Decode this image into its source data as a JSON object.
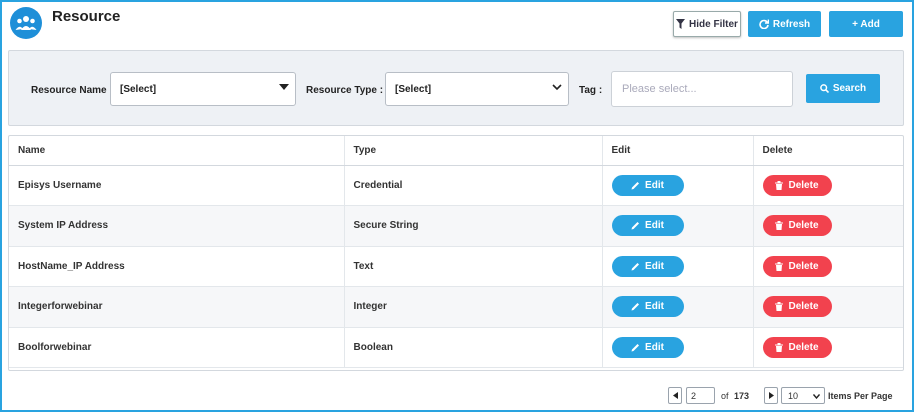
{
  "header": {
    "title": "Resource",
    "hide_filter_label": "Hide Filter",
    "refresh_label": "Refresh",
    "add_label": "+ Add"
  },
  "filter": {
    "resource_name_label": "Resource Name :",
    "resource_name_value": "[Select]",
    "resource_type_label": "Resource Type :",
    "resource_type_value": "[Select]",
    "tag_label": "Tag :",
    "tag_placeholder": "Please select...",
    "search_label": "Search"
  },
  "table": {
    "columns": [
      "Name",
      "Type",
      "Edit",
      "Delete"
    ],
    "rows": [
      {
        "name": "Episys Username",
        "type": "Credential"
      },
      {
        "name": "System IP Address",
        "type": "Secure String"
      },
      {
        "name": "HostName_IP Address",
        "type": "Text"
      },
      {
        "name": "Integerforwebinar",
        "type": "Integer"
      },
      {
        "name": "Boolforwebinar",
        "type": "Boolean"
      }
    ],
    "edit_label": "Edit",
    "delete_label": "Delete"
  },
  "pagination": {
    "current_page": "2",
    "of_label": "of",
    "total_pages": "173",
    "items_per_page": "10",
    "items_per_page_label": "Items Per Page"
  },
  "colors": {
    "accent": "#29a3e0",
    "danger": "#f2424e",
    "border": "#29a3e0"
  }
}
